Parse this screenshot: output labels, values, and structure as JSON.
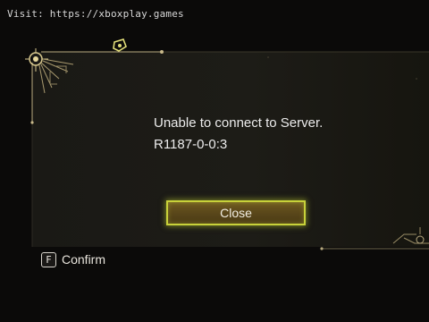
{
  "watermark": {
    "text": "Visit: https://xboxplay.games"
  },
  "dialog": {
    "message_line1": "Unable to connect to Server.",
    "message_line2": "R1187-0-0:3",
    "close_label": "Close"
  },
  "footer": {
    "confirm_key": "F",
    "confirm_label": "Confirm"
  },
  "colors": {
    "button_glow": "#c8d23a",
    "button_fill": "#5a471a",
    "ornament": "#c9b98a",
    "background": "#0b0a09"
  }
}
